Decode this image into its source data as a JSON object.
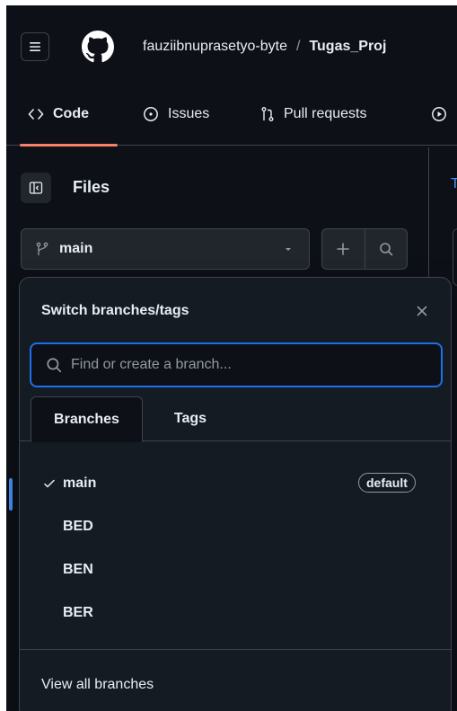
{
  "header": {
    "owner": "fauziibnuprasetyo-byte",
    "separator": "/",
    "repo": "Tugas_Proj"
  },
  "tabs": [
    {
      "label": "Code",
      "icon": "code-icon"
    },
    {
      "label": "Issues",
      "icon": "issue-circle-icon"
    },
    {
      "label": "Pull requests",
      "icon": "pull-request-icon"
    }
  ],
  "sidebar": {
    "title": "Files",
    "current_branch": "main",
    "right_hint": "T"
  },
  "dropdown": {
    "title": "Switch branches/tags",
    "search_placeholder": "Find or create a branch...",
    "tab_branches": "Branches",
    "tab_tags": "Tags",
    "branches": [
      {
        "name": "main",
        "default_label": "default",
        "selected": true
      },
      {
        "name": "BED"
      },
      {
        "name": "BEN"
      },
      {
        "name": "BER"
      }
    ],
    "view_all": "View all branches"
  },
  "colors": {
    "background": "#0d1117",
    "panel": "#151b23",
    "border": "#3d444d",
    "accent_blue": "#1f6feb",
    "tab_underline": "#f78166",
    "text": "#e6edf3",
    "muted": "#9198a1"
  }
}
